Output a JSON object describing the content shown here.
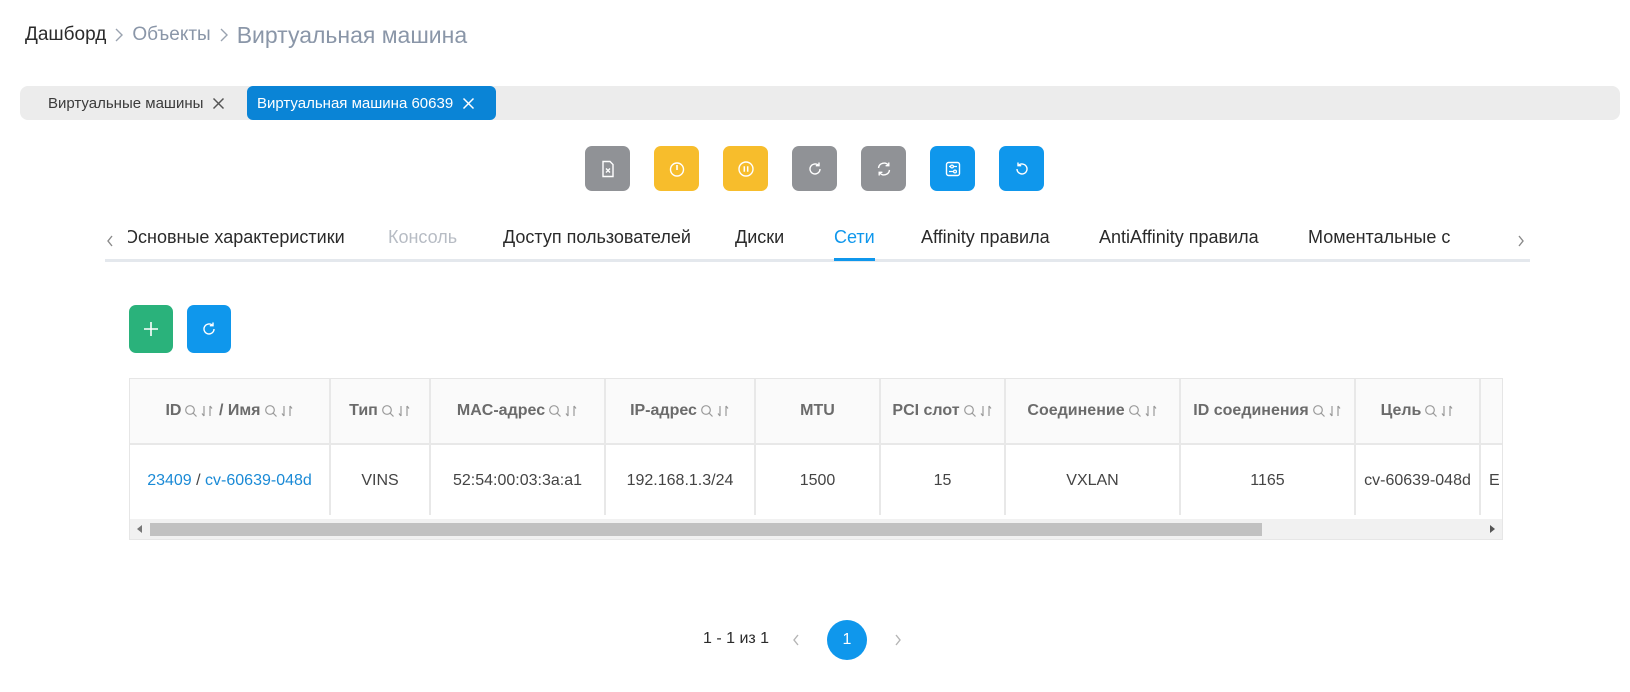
{
  "breadcrumb": {
    "items": [
      "Дашборд",
      "Объекты"
    ],
    "current": "Виртуальная машина"
  },
  "open_tabs": [
    {
      "label": "Виртуальные машины",
      "active": false
    },
    {
      "label": "Виртуальная машина 60639",
      "active": true
    }
  ],
  "toolbar": {
    "buttons": [
      {
        "icon": "delete-file-icon",
        "color": "#909296"
      },
      {
        "icon": "power-icon",
        "color": "#f7bd2c"
      },
      {
        "icon": "pause-icon",
        "color": "#f7bd2c"
      },
      {
        "icon": "reboot-icon",
        "color": "#909296"
      },
      {
        "icon": "reset-icon",
        "color": "#909296"
      },
      {
        "icon": "settings-list-icon",
        "color": "#0f97ec"
      },
      {
        "icon": "refresh-icon",
        "color": "#0f97ec"
      }
    ]
  },
  "sections": {
    "tabs": [
      {
        "label": "Основные характеристики",
        "state": "normal"
      },
      {
        "label": "Консоль",
        "state": "disabled"
      },
      {
        "label": "Доступ пользователей",
        "state": "normal"
      },
      {
        "label": "Диски",
        "state": "normal"
      },
      {
        "label": "Сети",
        "state": "active"
      },
      {
        "label": "Affinity правила",
        "state": "normal"
      },
      {
        "label": "AntiAffinity правила",
        "state": "normal"
      },
      {
        "label": "Моментальные с",
        "state": "normal"
      }
    ]
  },
  "actions": {
    "add_icon": "plus-icon",
    "refresh_icon": "refresh-icon"
  },
  "table": {
    "headers": {
      "id": "ID",
      "slash": "/",
      "name": "Имя",
      "type": "Тип",
      "mac": "MAC-адрес",
      "ip": "IP-адрес",
      "mtu": "MTU",
      "pci": "PCI слот",
      "conn": "Соединение",
      "conn_id": "ID соединения",
      "target": "Цель"
    },
    "rows": [
      {
        "id": "23409",
        "sep": " / ",
        "name": "cv-60639-048d",
        "type": "VINS",
        "mac": "52:54:00:03:3a:a1",
        "ip": "192.168.1.3/24",
        "mtu": "1500",
        "pci": "15",
        "conn": "VXLAN",
        "conn_id": "1165",
        "target": "cv-60639-048d",
        "extra": "E"
      }
    ]
  },
  "pagination": {
    "info": "1 - 1 из 1",
    "current_page": "1"
  },
  "colors": {
    "accent": "#0f97ec",
    "active_tab": "#0a84d6",
    "warning": "#f7bd2c",
    "success": "#2ab27b",
    "neutral": "#909296"
  }
}
